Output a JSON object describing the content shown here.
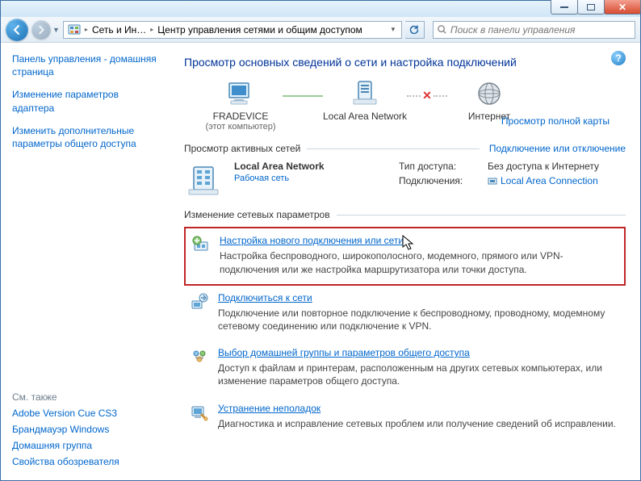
{
  "titlebar": {
    "min": "–",
    "max": "▢",
    "close": "✕"
  },
  "nav": {
    "back": "←",
    "fwd": "→",
    "crumb1": "Сеть и Ин…",
    "crumb2": "Центр управления сетями и общим доступом",
    "search_placeholder": "Поиск в панели управления"
  },
  "sidebar": {
    "top": [
      "Панель управления - домашняя страница",
      "Изменение параметров адаптера",
      "Изменить дополнительные параметры общего доступа"
    ],
    "see_also_label": "См. также",
    "see_also": [
      "Adobe Version Cue CS3",
      "Брандмауэр Windows",
      "Домашняя группа",
      "Свойства обозревателя"
    ]
  },
  "content": {
    "title": "Просмотр основных сведений о сети и настройка подключений",
    "map_link": "Просмотр полной карты",
    "nodes": {
      "this_pc": "FRADEVICE",
      "this_pc_sub": "(этот компьютер)",
      "network": "Local Area Network",
      "internet": "Интернет"
    },
    "active_hdr": "Просмотр активных сетей",
    "active_rlink": "Подключение или отключение",
    "active": {
      "name": "Local Area Network",
      "type": "Рабочая сеть",
      "access_k": "Тип доступа:",
      "access_v": "Без доступа к Интернету",
      "conn_k": "Подключения:",
      "conn_v": "Local Area Connection"
    },
    "change_hdr": "Изменение сетевых параметров",
    "tasks": [
      {
        "link": "Настройка нового подключения или сети",
        "desc": "Настройка беспроводного, широкополосного, модемного, прямого или VPN-подключения или же настройка маршрутизатора или точки доступа.",
        "hl": true
      },
      {
        "link": "Подключиться к сети",
        "desc": "Подключение или повторное подключение к беспроводному, проводному, модемному сетевому соединению или подключение к VPN."
      },
      {
        "link": "Выбор домашней группы и параметров общего доступа",
        "desc": "Доступ к файлам и принтерам, расположенным на других сетевых компьютерах, или изменение параметров общего доступа."
      },
      {
        "link": "Устранение неполадок",
        "desc": "Диагностика и исправление сетевых проблем или получение сведений об исправлении."
      }
    ]
  }
}
